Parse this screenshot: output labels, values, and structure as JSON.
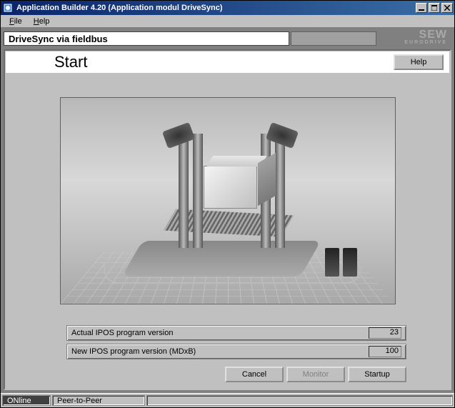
{
  "window": {
    "title": "Application Builder  4.20 (Application modul DriveSync)"
  },
  "menu": {
    "file": "File",
    "help": "Help"
  },
  "header": {
    "label": "DriveSync via fieldbus",
    "brand_top": "SEW",
    "brand_sub": "EURODRIVE"
  },
  "start": {
    "title": "Start",
    "help_btn": "Help"
  },
  "version": {
    "actual_label": "Actual   IPOS program version",
    "actual_value": "23",
    "new_label": "New    IPOS program version (MDxB)",
    "new_value": "100"
  },
  "buttons": {
    "cancel": "Cancel",
    "monitor": "Monitor",
    "startup": "Startup"
  },
  "status": {
    "online": "ONline",
    "peer": "Peer-to-Peer"
  }
}
